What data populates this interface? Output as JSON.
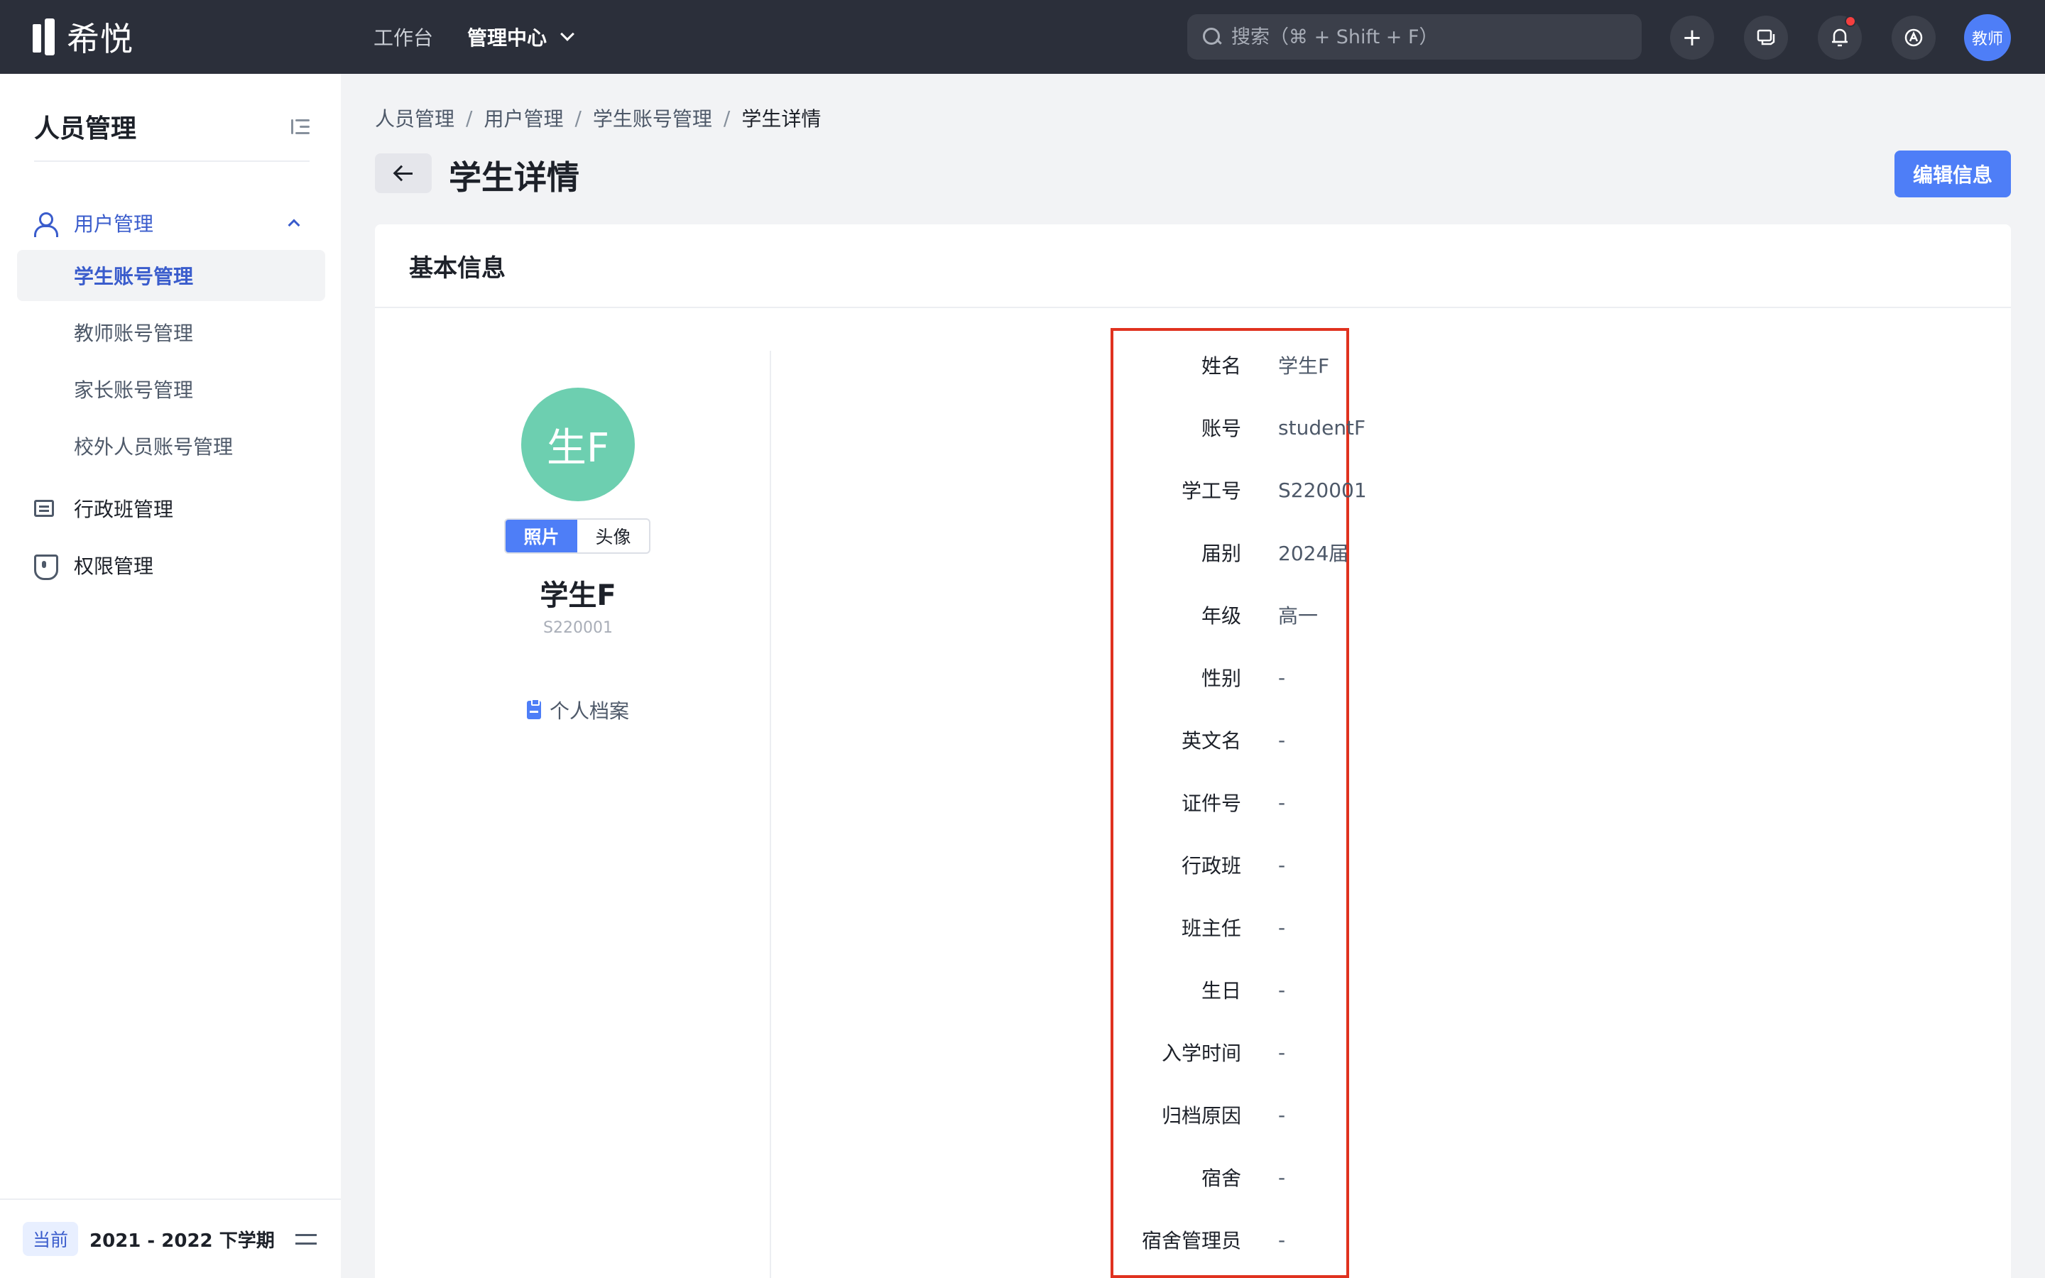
{
  "app": {
    "brand": "希悦",
    "nav": [
      {
        "label": "工作台"
      },
      {
        "label": "管理中心"
      }
    ],
    "search_placeholder": "搜索（⌘ + Shift + F）",
    "user_avatar": "教师"
  },
  "sidebar": {
    "title": "人员管理",
    "group_label": "用户管理",
    "sub_items": [
      {
        "label": "学生账号管理"
      },
      {
        "label": "教师账号管理"
      },
      {
        "label": "家长账号管理"
      },
      {
        "label": "校外人员账号管理"
      }
    ],
    "items": [
      {
        "label": "行政班管理",
        "icon": "class-icon"
      },
      {
        "label": "权限管理",
        "icon": "shield-icon"
      }
    ],
    "footer": {
      "badge": "当前",
      "term": "2021 - 2022 下学期"
    }
  },
  "breadcrumb": [
    "人员管理",
    "用户管理",
    "学生账号管理",
    "学生详情"
  ],
  "page": {
    "title": "学生详情",
    "edit_label": "编辑信息"
  },
  "card": {
    "title": "基本信息",
    "profile": {
      "avatar_text": "生F",
      "seg_photo": "照片",
      "seg_avatar": "头像",
      "name": "学生F",
      "id": "S220001",
      "archive_label": "个人档案"
    },
    "fields": [
      {
        "label": "姓名",
        "value": "学生F"
      },
      {
        "label": "账号",
        "value": "studentF"
      },
      {
        "label": "学工号",
        "value": "S220001"
      },
      {
        "label": "届别",
        "value": "2024届"
      },
      {
        "label": "年级",
        "value": "高一"
      },
      {
        "label": "性别",
        "value": "-"
      },
      {
        "label": "英文名",
        "value": "-"
      },
      {
        "label": "证件号",
        "value": "-"
      },
      {
        "label": "行政班",
        "value": "-"
      },
      {
        "label": "班主任",
        "value": "-"
      },
      {
        "label": "生日",
        "value": "-"
      },
      {
        "label": "入学时间",
        "value": "-"
      },
      {
        "label": "归档原因",
        "value": "-"
      },
      {
        "label": "宿舍",
        "value": "-"
      },
      {
        "label": "宿舍管理员",
        "value": "-"
      }
    ]
  },
  "colors": {
    "topbar": "#2b2f3a",
    "accent": "#4e7ef7",
    "avatar": "#6dcfb0",
    "highlight": "#e0321f"
  }
}
